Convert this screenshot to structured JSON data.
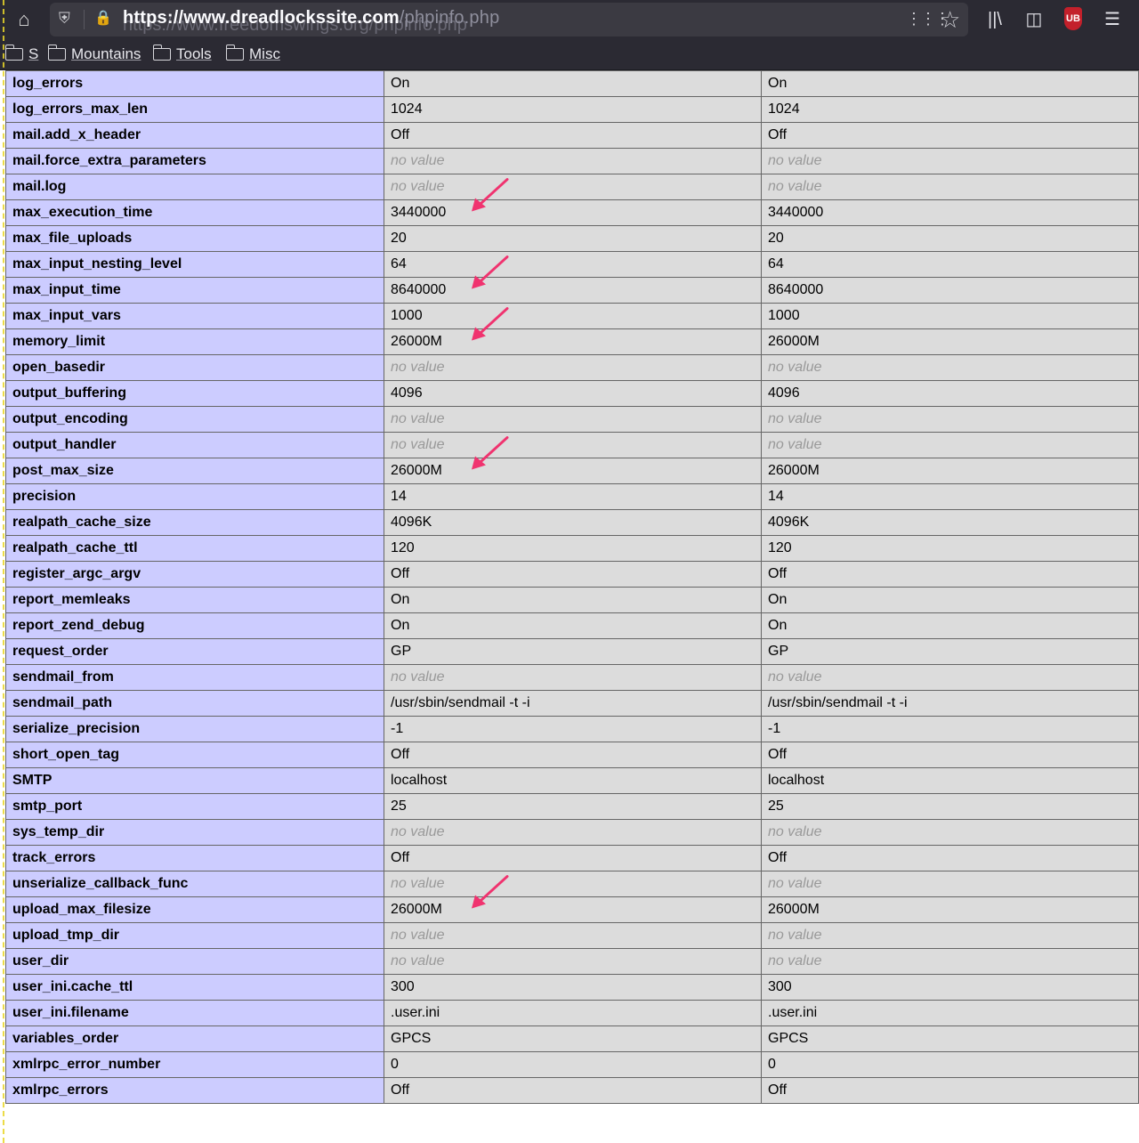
{
  "browser": {
    "url_host": "https://www.dreadlockssite.com",
    "url_path": "/phpinfo.php",
    "url_overlap": "https://www.freedomswings.org/phpinfo.php",
    "icons": [
      "home-icon",
      "shield-icon",
      "lock-icon",
      "page-actions-icon",
      "bookmark-star-icon",
      "library-icon",
      "sidebar-icon",
      "extension-icon",
      "menu-icon"
    ],
    "extension_label": "UB"
  },
  "bookmarks": {
    "items": [
      {
        "label": "S"
      },
      {
        "label": "Mountains"
      },
      {
        "label": "Tools"
      },
      {
        "label": "Misc"
      }
    ]
  },
  "phpinfo": {
    "header_color": "#ccccff",
    "value_bg": "#dcdcdc",
    "rows": [
      {
        "directive": "log_errors",
        "local": "On",
        "master": "On"
      },
      {
        "directive": "log_errors_max_len",
        "local": "1024",
        "master": "1024"
      },
      {
        "directive": "mail.add_x_header",
        "local": "Off",
        "master": "Off"
      },
      {
        "directive": "mail.force_extra_parameters",
        "local": "no value",
        "master": "no value"
      },
      {
        "directive": "mail.log",
        "local": "no value",
        "master": "no value"
      },
      {
        "directive": "max_execution_time",
        "local": "3440000",
        "master": "3440000"
      },
      {
        "directive": "max_file_uploads",
        "local": "20",
        "master": "20"
      },
      {
        "directive": "max_input_nesting_level",
        "local": "64",
        "master": "64"
      },
      {
        "directive": "max_input_time",
        "local": "8640000",
        "master": "8640000"
      },
      {
        "directive": "max_input_vars",
        "local": "1000",
        "master": "1000"
      },
      {
        "directive": "memory_limit",
        "local": "26000M",
        "master": "26000M"
      },
      {
        "directive": "open_basedir",
        "local": "no value",
        "master": "no value"
      },
      {
        "directive": "output_buffering",
        "local": "4096",
        "master": "4096"
      },
      {
        "directive": "output_encoding",
        "local": "no value",
        "master": "no value"
      },
      {
        "directive": "output_handler",
        "local": "no value",
        "master": "no value"
      },
      {
        "directive": "post_max_size",
        "local": "26000M",
        "master": "26000M"
      },
      {
        "directive": "precision",
        "local": "14",
        "master": "14"
      },
      {
        "directive": "realpath_cache_size",
        "local": "4096K",
        "master": "4096K"
      },
      {
        "directive": "realpath_cache_ttl",
        "local": "120",
        "master": "120"
      },
      {
        "directive": "register_argc_argv",
        "local": "Off",
        "master": "Off"
      },
      {
        "directive": "report_memleaks",
        "local": "On",
        "master": "On"
      },
      {
        "directive": "report_zend_debug",
        "local": "On",
        "master": "On"
      },
      {
        "directive": "request_order",
        "local": "GP",
        "master": "GP"
      },
      {
        "directive": "sendmail_from",
        "local": "no value",
        "master": "no value"
      },
      {
        "directive": "sendmail_path",
        "local": "/usr/sbin/sendmail -t -i",
        "master": "/usr/sbin/sendmail -t -i"
      },
      {
        "directive": "serialize_precision",
        "local": "-1",
        "master": "-1"
      },
      {
        "directive": "short_open_tag",
        "local": "Off",
        "master": "Off"
      },
      {
        "directive": "SMTP",
        "local": "localhost",
        "master": "localhost"
      },
      {
        "directive": "smtp_port",
        "local": "25",
        "master": "25"
      },
      {
        "directive": "sys_temp_dir",
        "local": "no value",
        "master": "no value"
      },
      {
        "directive": "track_errors",
        "local": "Off",
        "master": "Off"
      },
      {
        "directive": "unserialize_callback_func",
        "local": "no value",
        "master": "no value"
      },
      {
        "directive": "upload_max_filesize",
        "local": "26000M",
        "master": "26000M"
      },
      {
        "directive": "upload_tmp_dir",
        "local": "no value",
        "master": "no value"
      },
      {
        "directive": "user_dir",
        "local": "no value",
        "master": "no value"
      },
      {
        "directive": "user_ini.cache_ttl",
        "local": "300",
        "master": "300"
      },
      {
        "directive": "user_ini.filename",
        "local": ".user.ini",
        "master": ".user.ini"
      },
      {
        "directive": "variables_order",
        "local": "GPCS",
        "master": "GPCS"
      },
      {
        "directive": "xmlrpc_error_number",
        "local": "0",
        "master": "0"
      },
      {
        "directive": "xmlrpc_errors",
        "local": "Off",
        "master": "Off"
      }
    ]
  },
  "annotations": {
    "arrow_color": "#f0336f",
    "arrow_rows": [
      "max_execution_time",
      "max_input_time",
      "memory_limit",
      "post_max_size",
      "upload_max_filesize"
    ]
  }
}
